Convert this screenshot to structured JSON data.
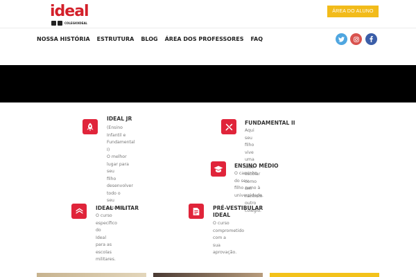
{
  "header": {
    "logo_text": "ideal",
    "logo_handle": "COLEGIOIDEAL",
    "cta_label": "ÁREA DO ALUNO"
  },
  "nav": {
    "items": [
      "NOSSA HISTÓRIA",
      "ESTRUTURA",
      "BLOG",
      "ÁREA DOS PROFESSORES",
      "FAQ"
    ]
  },
  "social": {
    "twitter_icon": "twitter-icon",
    "instagram_icon": "instagram-icon",
    "facebook_icon": "facebook-icon"
  },
  "features": {
    "jr": {
      "icon": "rocket-icon",
      "title": "IDEAL JR",
      "lines": [
        "(Ensino Infantil e",
        "Fundamental I)",
        "O melhor lugar para seu",
        "filho desenvolver todo o",
        "seu potencial"
      ]
    },
    "fund2": {
      "icon": "pencil-ruler-icon",
      "title": "FUNDAMENTAL II",
      "lines": [
        "Aqui seu filho vive uma vida",
        "escolar como em nenhum",
        "outro colégio."
      ]
    },
    "medio": {
      "icon": "graduation-cap-icon",
      "title": "ENSINO MÉDIO",
      "lines": [
        "O caminho do seu",
        "filho rumo à",
        "universidade."
      ]
    },
    "militar": {
      "icon": "chevron-rank-icon",
      "title": "IDEAL MILITAR",
      "lines": [
        "O curso específico do",
        "Ideal para as escolas",
        "militares."
      ]
    },
    "prevest": {
      "icon": "document-edit-icon",
      "title_lines": [
        "PRÉ-VESTIBULAR",
        "IDEAL"
      ],
      "lines": [
        "O curso",
        "comprometido com a",
        "sua aprovação."
      ]
    }
  },
  "colors": {
    "brand_red": "#e0243a",
    "cta_yellow": "#f2bb1a"
  }
}
